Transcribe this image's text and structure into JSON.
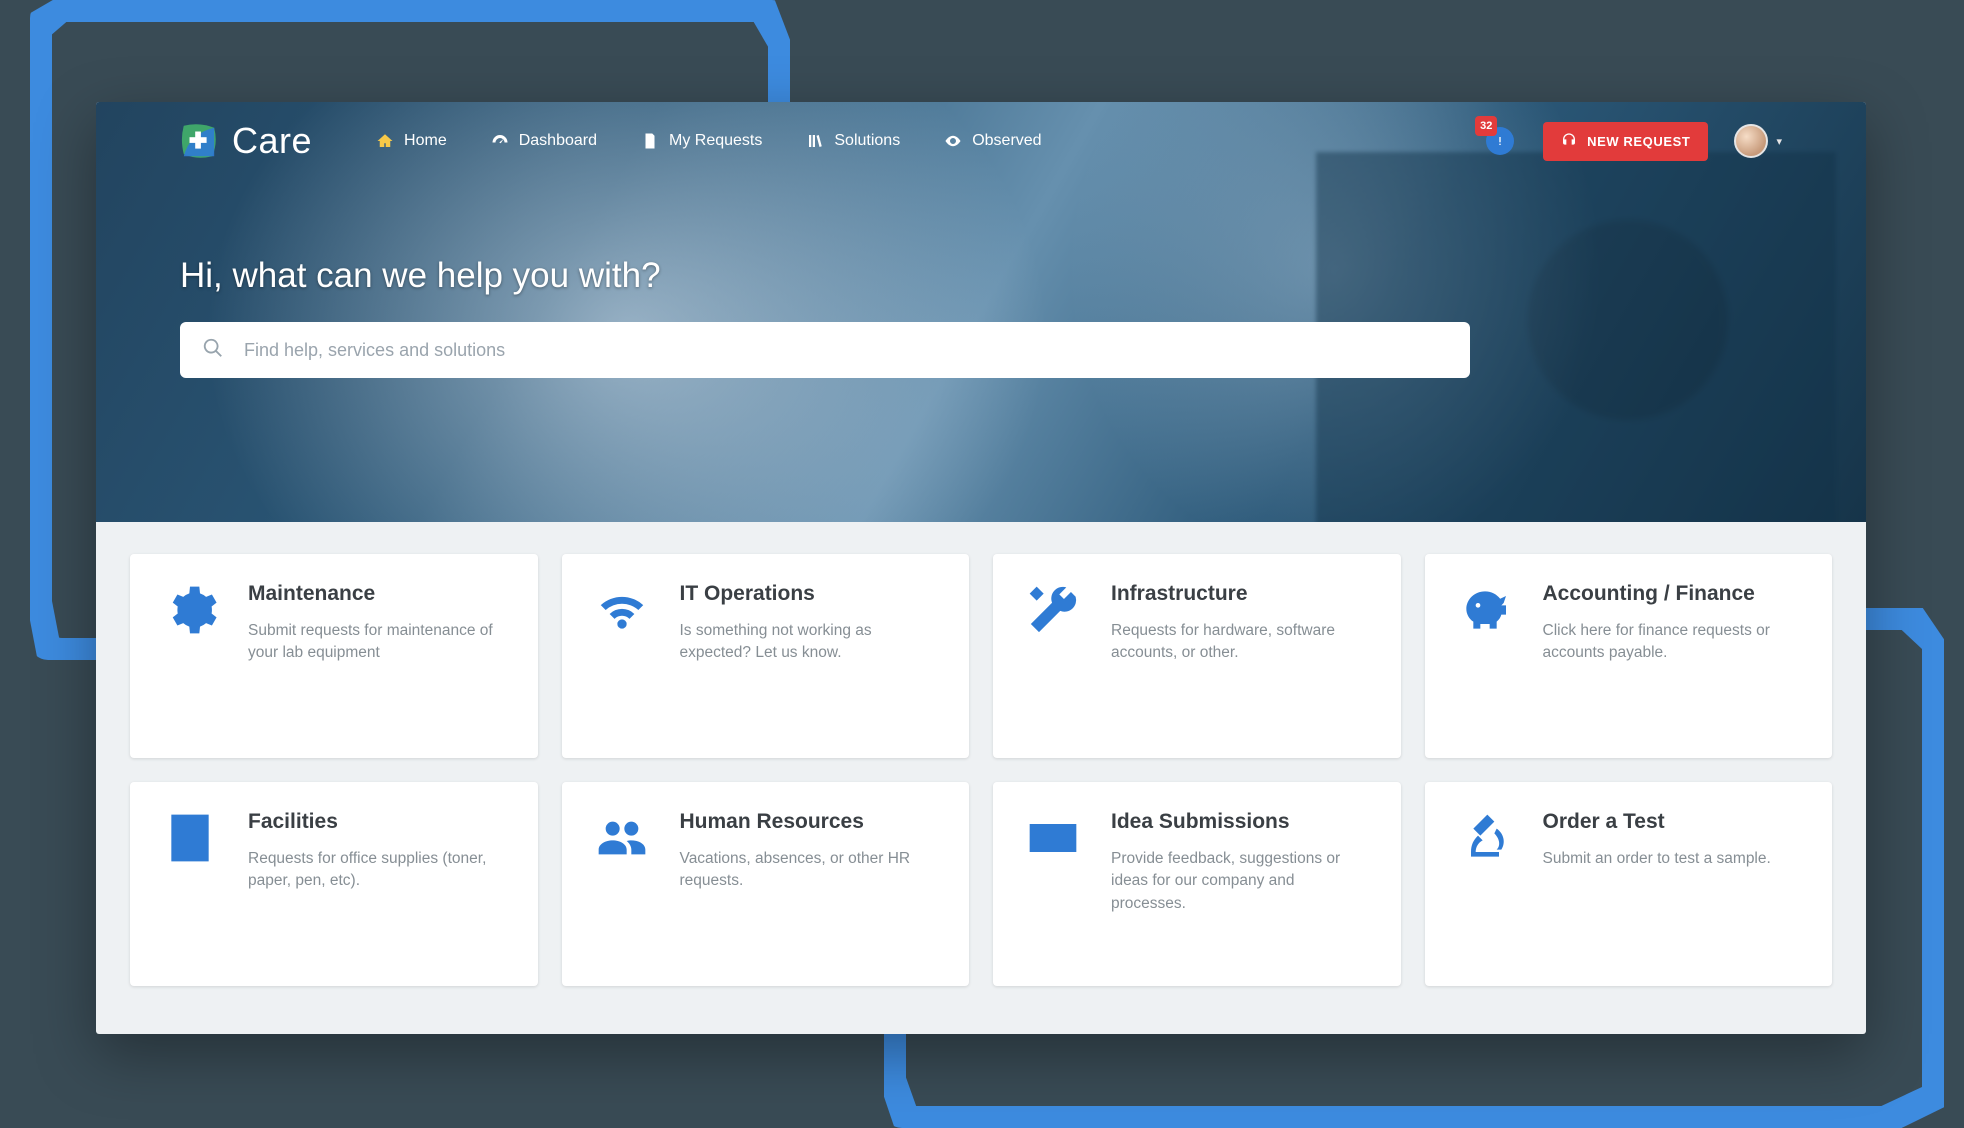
{
  "brand": {
    "name": "Care"
  },
  "nav": [
    {
      "label": "Home",
      "icon": "home-icon",
      "active": true
    },
    {
      "label": "Dashboard",
      "icon": "gauge-icon",
      "active": false
    },
    {
      "label": "My Requests",
      "icon": "document-icon",
      "active": false
    },
    {
      "label": "Solutions",
      "icon": "library-icon",
      "active": false
    },
    {
      "label": "Observed",
      "icon": "eye-icon",
      "active": false
    }
  ],
  "notifications": {
    "count": "32"
  },
  "new_request_label": "NEW REQUEST",
  "hero": {
    "title": "Hi, what can we help you with?",
    "search_placeholder": "Find help, services and solutions"
  },
  "cards": [
    {
      "icon": "gear-icon",
      "title": "Maintenance",
      "desc": "Submit requests for maintenance of your lab equipment"
    },
    {
      "icon": "wifi-icon",
      "title": "IT Operations",
      "desc": "Is something not working as expected? Let us know."
    },
    {
      "icon": "tools-icon",
      "title": "Infrastructure",
      "desc": "Requests for hardware, software accounts, or other."
    },
    {
      "icon": "piggy-icon",
      "title": "Accounting / Finance",
      "desc": "Click here for finance requests or accounts payable."
    },
    {
      "icon": "building-icon",
      "title": "Facilities",
      "desc": "Requests for office supplies (toner, paper, pen, etc)."
    },
    {
      "icon": "users-icon",
      "title": "Human Resources",
      "desc": "Vacations, absences, or other HR requests."
    },
    {
      "icon": "keyboard-icon",
      "title": "Idea Submissions",
      "desc": "Provide feedback, suggestions or ideas for our company and processes."
    },
    {
      "icon": "microscope-icon",
      "title": "Order a Test",
      "desc": "Submit an order to test a sample."
    }
  ],
  "colors": {
    "accent": "#2f7bd4",
    "danger": "#e23b3b"
  }
}
